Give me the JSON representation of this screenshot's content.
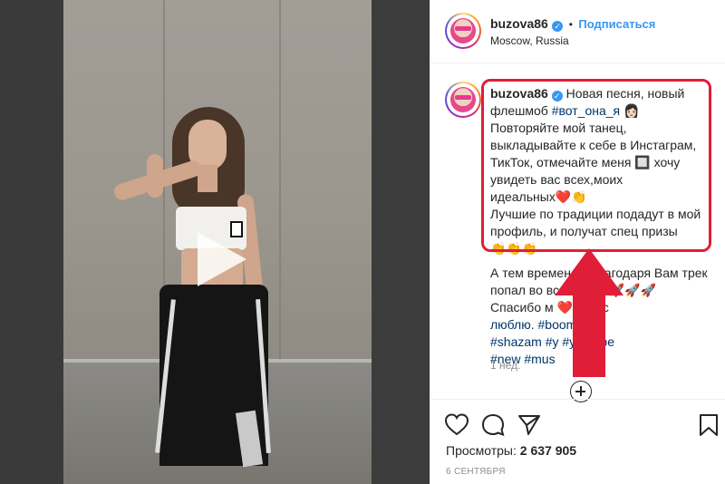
{
  "post": {
    "username": "buzova86",
    "follow_label": "Подписаться",
    "separator": "•",
    "location": "Moscow, Russia",
    "caption_lines": [
      "Новая песня, новый",
      "флешмоб",
      "#вот_она_я",
      "Повторяйте мой танец,",
      "выкладывайте к себе в Инстаграм,",
      "ТикТок, отмечайте меня 🔲 хочу",
      "увидеть вас всех,моих",
      "идеальных❤️👏",
      "Лучшие по традиции подадут в мой",
      "профиль, и получат спец призы",
      "👏👏👏"
    ],
    "caption_more_lines": [
      "А тем временем благодаря Вам трек",
      "попал во все чарты 🚀🚀🚀",
      "Спасибо м ❤️ Я вас",
      "люблю. #boom #vk",
      "#shazam #y #youtube",
      "#new #mus"
    ],
    "time_ago": "1 нед.",
    "views_label": "Просмотры:",
    "views_count": "2 637 905",
    "date": "6 СЕНТЯБРЯ"
  },
  "icons": {
    "verified": "verified-badge-icon",
    "play": "play-icon",
    "load_more": "plus-circle-icon",
    "like": "heart-icon",
    "comment": "comment-icon",
    "share": "share-icon",
    "save": "bookmark-icon",
    "annotation_arrow": "arrow-up-icon"
  },
  "colors": {
    "accent": "#3897f0",
    "annotation": "#e01e37",
    "hashtag": "#003569"
  }
}
